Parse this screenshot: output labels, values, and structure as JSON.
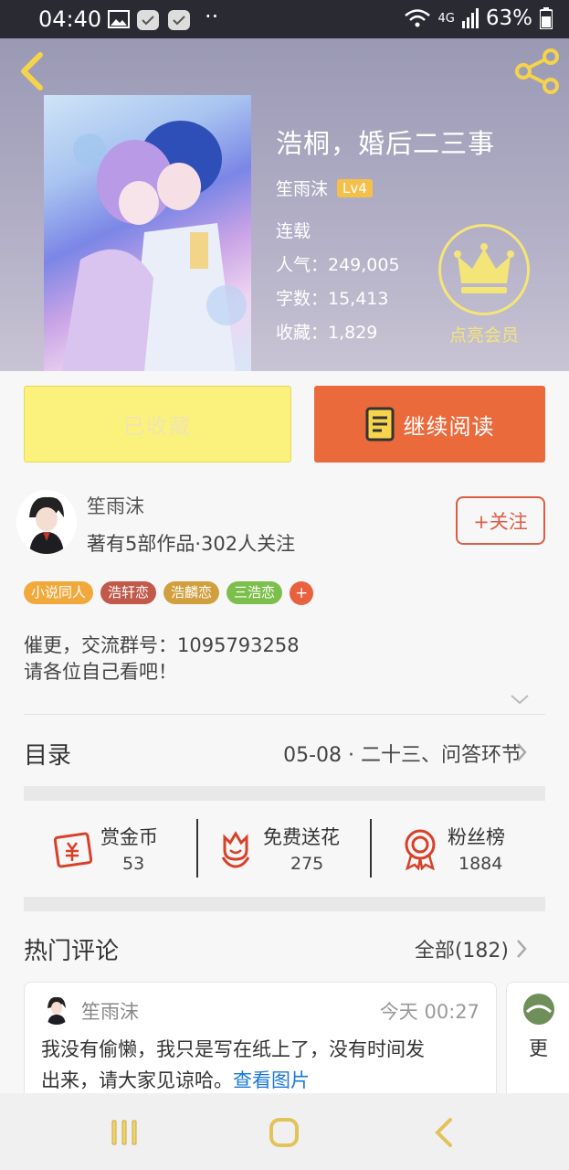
{
  "status_bar": {
    "time": "04:40",
    "dots": "··",
    "network": "4G",
    "battery": "63%"
  },
  "book": {
    "title": "浩桐，婚后二三事",
    "author": "笙雨沫",
    "level": "Lv4",
    "status": "连载",
    "popularity": "人气：249,005",
    "word_count": "字数：15,413",
    "favorites": "收藏：1,829"
  },
  "vip": {
    "label": "点亮会员"
  },
  "actions": {
    "collected": "已收藏",
    "continue_reading": "继续阅读"
  },
  "author_info": {
    "name": "笙雨沫",
    "stats": "著有5部作品·302人关注",
    "follow": "+关注"
  },
  "tags": [
    {
      "label": "小说同人",
      "color": "#f2a93b"
    },
    {
      "label": "浩轩恋",
      "color": "#c25a4b"
    },
    {
      "label": "浩麟恋",
      "color": "#d1a03e"
    },
    {
      "label": "三浩恋",
      "color": "#7dbf4c"
    }
  ],
  "tag_add": "+",
  "description": {
    "line1": "催更，交流群号：1095793258",
    "line2": "请各位自己看吧！"
  },
  "catalog": {
    "label": "目录",
    "latest": "05-08 · 二十三、问答环节"
  },
  "stats": [
    {
      "label": "赏金币",
      "value": "53"
    },
    {
      "label": "免费送花",
      "value": "275"
    },
    {
      "label": "粉丝榜",
      "value": "1884"
    }
  ],
  "hot_comments": {
    "label": "热门评论",
    "all": "全部(182)",
    "comment": {
      "user": "笙雨沫",
      "time": "今天 00:27",
      "text_line1": "我没有偷懒，我只是写在纸上了，没有时间发",
      "text_line2": "出来，请大家见谅哈。",
      "link": "查看图片"
    },
    "peek_text": "更"
  },
  "colors": {
    "accent": "#ea6a3c",
    "collected_bg": "#fbf17d",
    "vip": "#f4e579",
    "link": "#1a78d8"
  }
}
